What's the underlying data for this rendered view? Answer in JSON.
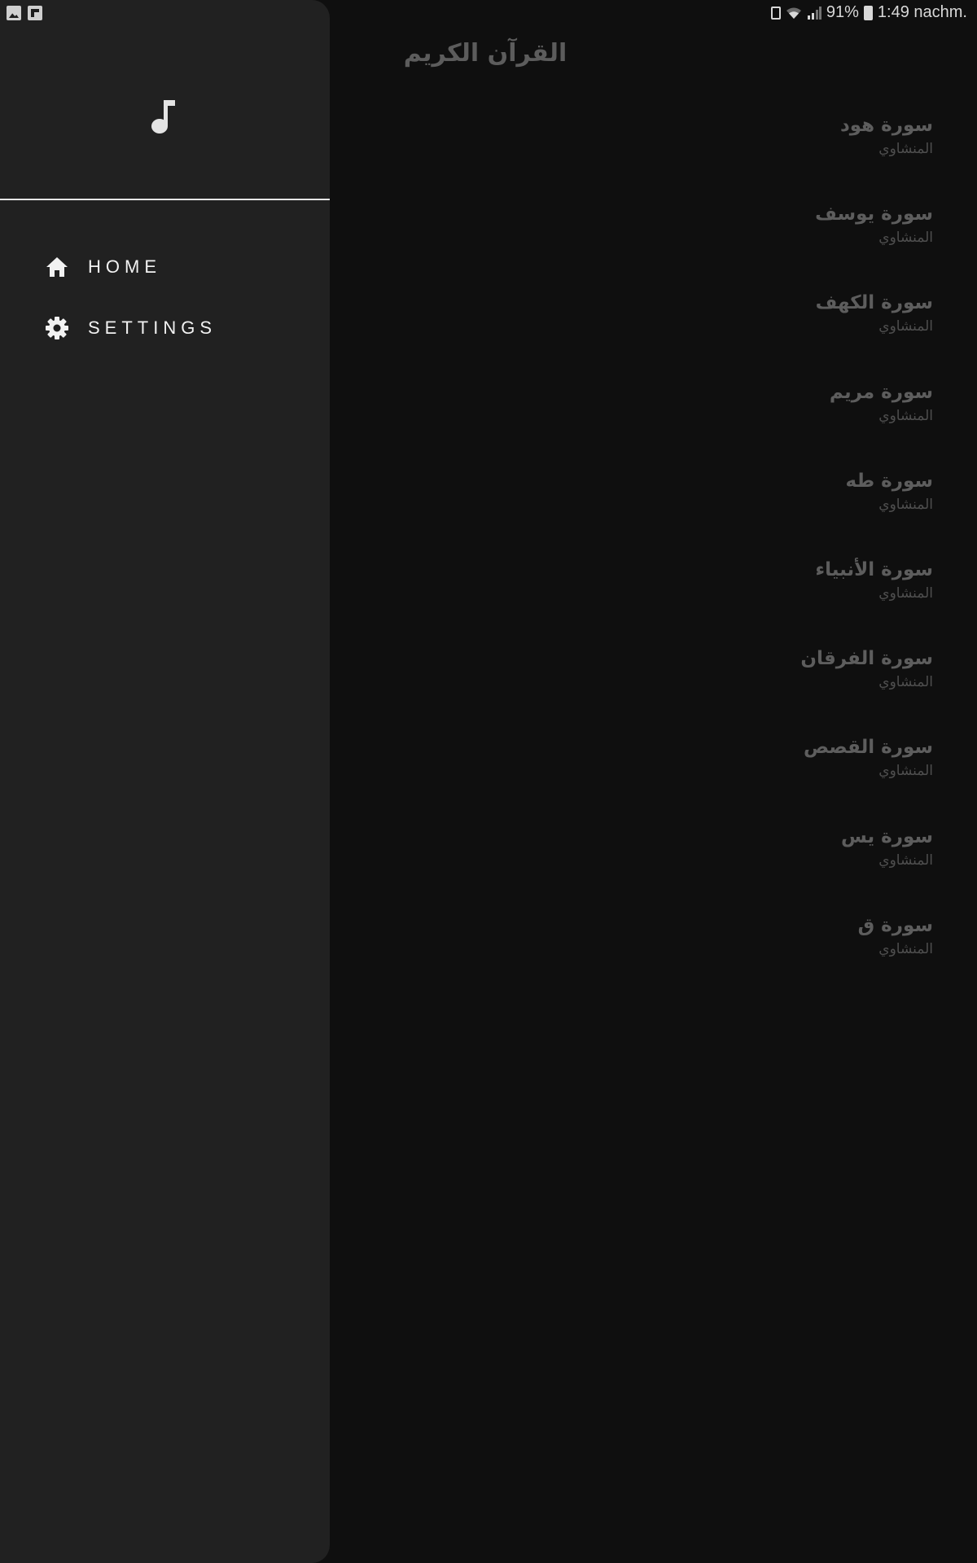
{
  "status_bar": {
    "battery_percent": "91%",
    "time": "1:49 nachm.",
    "icons": [
      "gallery-icon",
      "flipboard-icon",
      "battery-saver-icon",
      "wifi-icon",
      "signal-icon",
      "battery-icon"
    ]
  },
  "app": {
    "title": "القرآن الكريم"
  },
  "drawer": {
    "header_icon": "music-note-icon",
    "items": [
      {
        "label": "HOME",
        "icon": "home-icon"
      },
      {
        "label": "SETTINGS",
        "icon": "gear-icon"
      }
    ]
  },
  "surahs": [
    {
      "name": "سورة هود",
      "reciter": "المنشاوي"
    },
    {
      "name": "سورة يوسف",
      "reciter": "المنشاوي"
    },
    {
      "name": "سورة الكهف",
      "reciter": "المنشاوي"
    },
    {
      "name": "سورة مريم",
      "reciter": "المنشاوي"
    },
    {
      "name": "سورة طه",
      "reciter": "المنشاوي"
    },
    {
      "name": "سورة الأنبياء",
      "reciter": "المنشاوي"
    },
    {
      "name": "سورة الفرقان",
      "reciter": "المنشاوي"
    },
    {
      "name": "سورة القصص",
      "reciter": "المنشاوي"
    },
    {
      "name": "سورة يس",
      "reciter": "المنشاوي"
    },
    {
      "name": "سورة ق",
      "reciter": "المنشاوي"
    }
  ],
  "colors": {
    "background": "#0f0f0f",
    "drawer": "#212121",
    "drawer_text": "#f2f2f2",
    "list_text": "#5d5d5d"
  }
}
